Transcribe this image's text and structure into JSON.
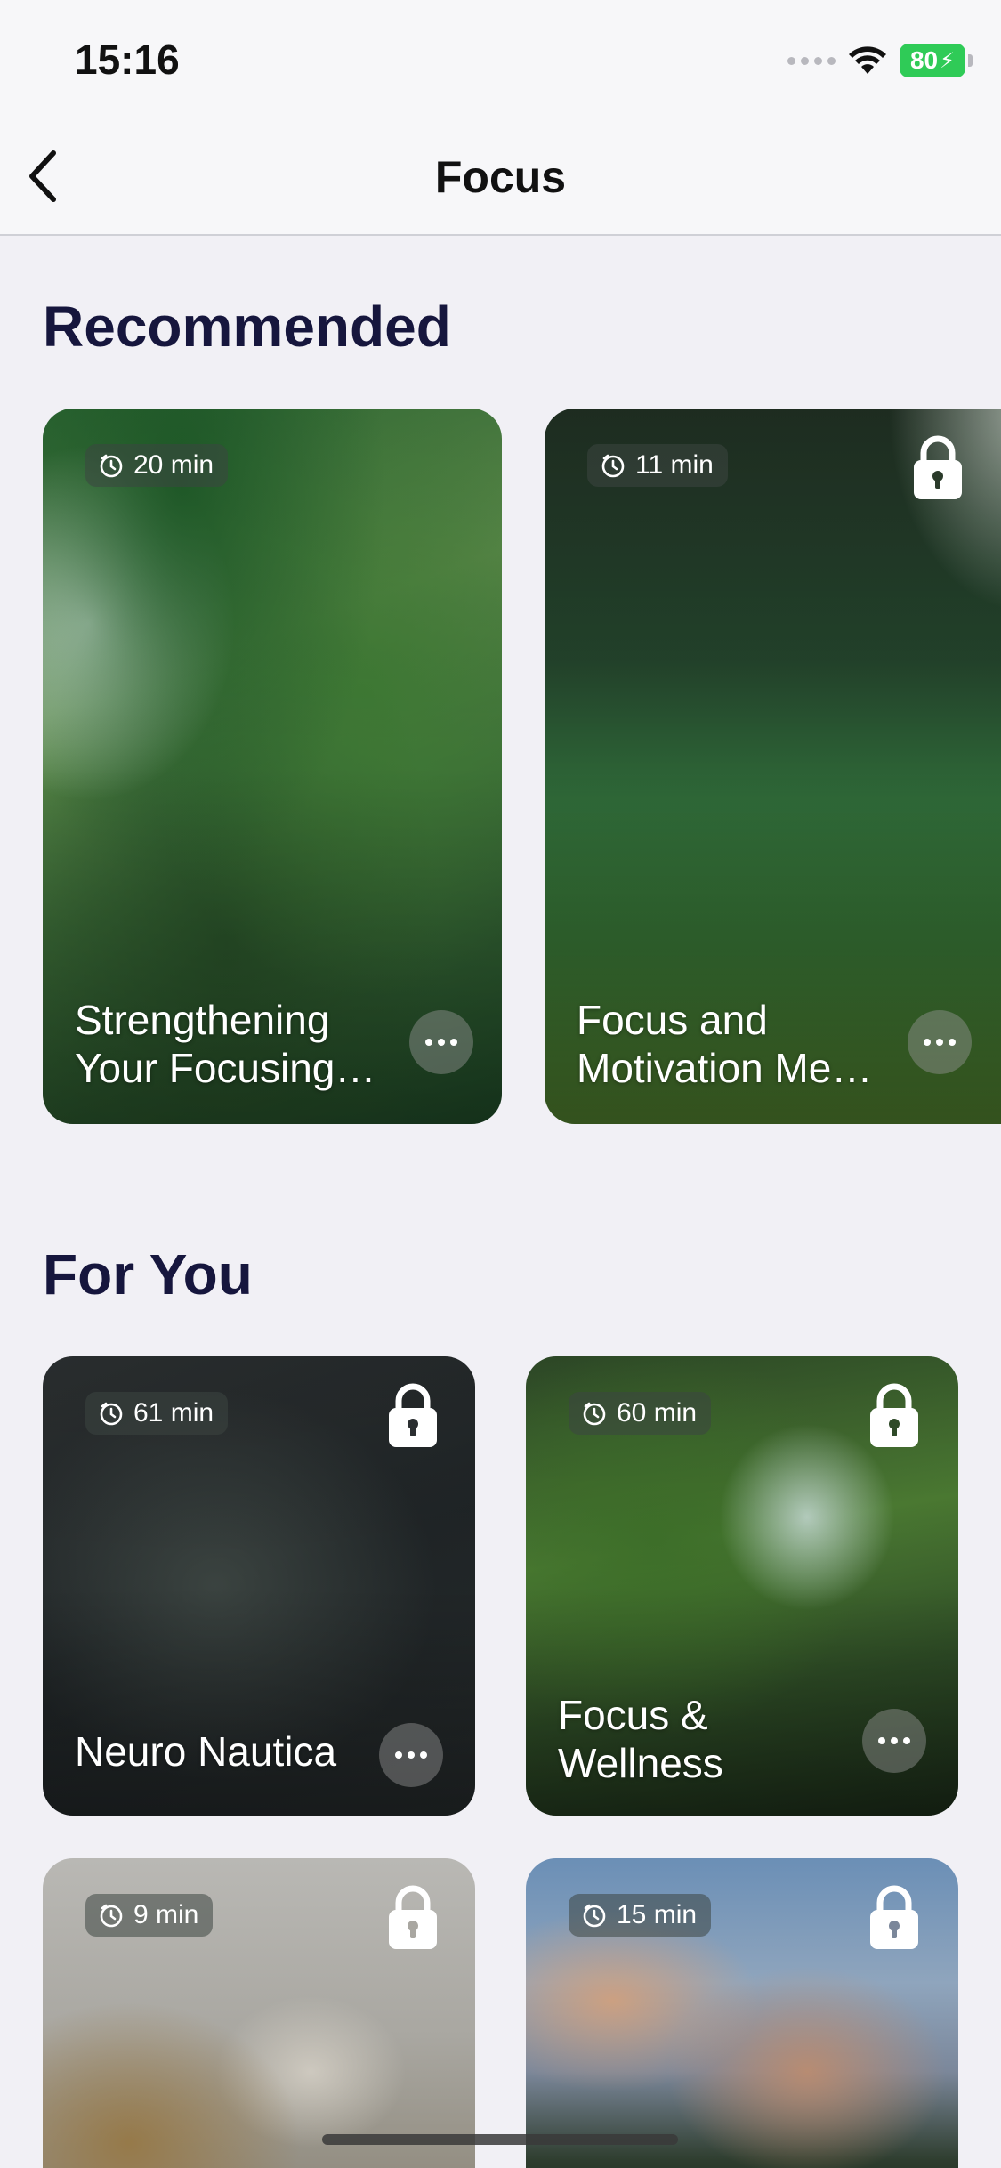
{
  "status_bar": {
    "time": "15:16",
    "battery": "80"
  },
  "nav": {
    "title": "Focus"
  },
  "sections": {
    "recommended": "Recommended",
    "for_you": "For You"
  },
  "recommended": [
    {
      "duration": "20 min",
      "title": "Strengthening Your Focusing…",
      "locked": false
    },
    {
      "duration": "11 min",
      "title": "Focus and Motivation Me…",
      "locked": true
    }
  ],
  "for_you": [
    {
      "duration": "61 min",
      "title": "Neuro Nautica",
      "locked": true
    },
    {
      "duration": "60 min",
      "title": "Focus & Wellness",
      "locked": true
    },
    {
      "duration": "9 min",
      "title": "",
      "locked": true
    },
    {
      "duration": "15 min",
      "title": "",
      "locked": true
    }
  ],
  "colors": {
    "background": "#f1f0f5",
    "heading": "#16163d",
    "battery": "#2fcb57"
  },
  "icons": [
    "back-chevron-icon",
    "clock-icon",
    "lock-icon",
    "more-dots-icon",
    "wifi-icon",
    "battery-icon"
  ]
}
